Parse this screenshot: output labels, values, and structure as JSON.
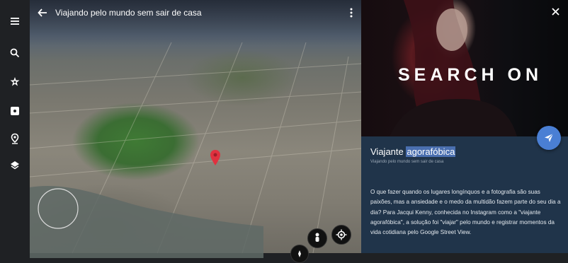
{
  "rail": {
    "icons": [
      "menu-icon",
      "search-icon",
      "voyager-icon",
      "dice-icon",
      "place-icon",
      "layers-icon"
    ]
  },
  "map": {
    "title": "Viajando pelo mundo sem sair de casa"
  },
  "panel": {
    "hero_text": "SEARCH ON",
    "title_prefix": "Viajante ",
    "title_highlight": "agorafóbica",
    "subtitle": "Viajando pelo mundo sem sair de casa",
    "body": "O que fazer quando os lugares longínquos e a fotografia são suas paixões, mas a ansiedade e o medo da multidão fazem parte do seu dia a dia? Para Jacqui Kenny, conhecida no Instagram como a \"viajante agorafóbica\", a solução foi \"viajar\" pelo mundo e registrar momentos da vida cotidiana pelo Google Street View."
  },
  "colors": {
    "rail_bg": "#1f2124",
    "panel_bg": "#20344a",
    "accent": "#4a7fd4",
    "pin": "#e0313f"
  }
}
